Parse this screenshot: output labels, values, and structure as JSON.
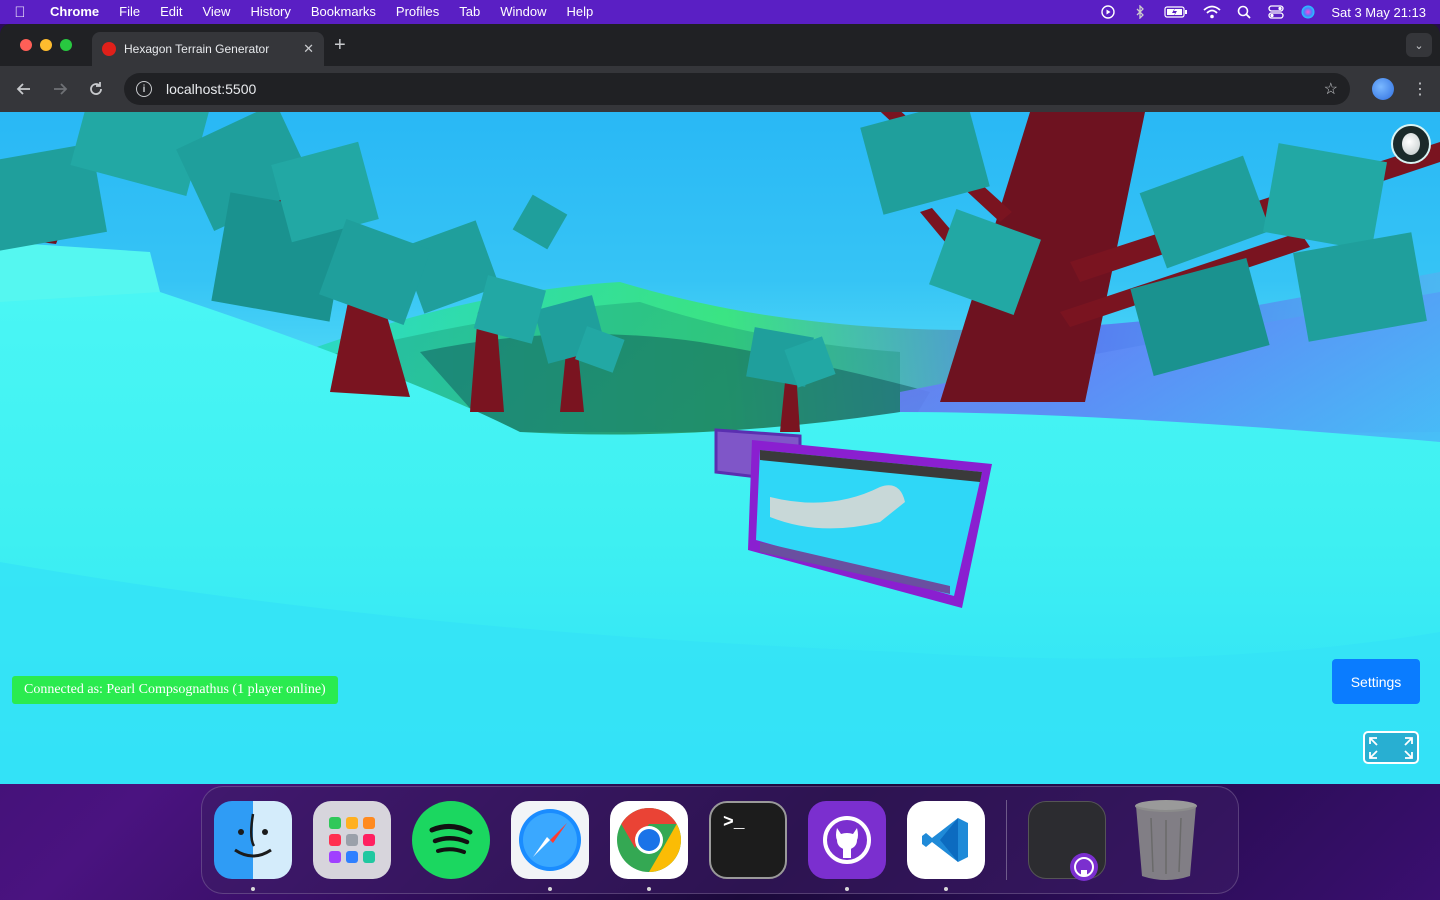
{
  "menubar": {
    "app": "Chrome",
    "items": [
      "File",
      "Edit",
      "View",
      "History",
      "Bookmarks",
      "Profiles",
      "Tab",
      "Window",
      "Help"
    ],
    "clock": "Sat 3 May  21:13"
  },
  "browser": {
    "tab_title": "Hexagon Terrain Generator",
    "url": "localhost:5500"
  },
  "game": {
    "status_text": "Connected as: Pearl Compsognathus (1 player online)",
    "settings_label": "Settings"
  },
  "dock": {
    "apps": [
      "Finder",
      "Launchpad",
      "Spotify",
      "Safari",
      "Google Chrome",
      "Terminal",
      "GitHub Desktop",
      "Visual Studio Code",
      "Window Preview",
      "Trash"
    ]
  },
  "colors": {
    "menubar": "#5a1fc4",
    "status_bg": "#2aeb4f",
    "settings_bg": "#0a7cff",
    "trunk": "#7a1420",
    "foliage": "#1f9f9c"
  }
}
